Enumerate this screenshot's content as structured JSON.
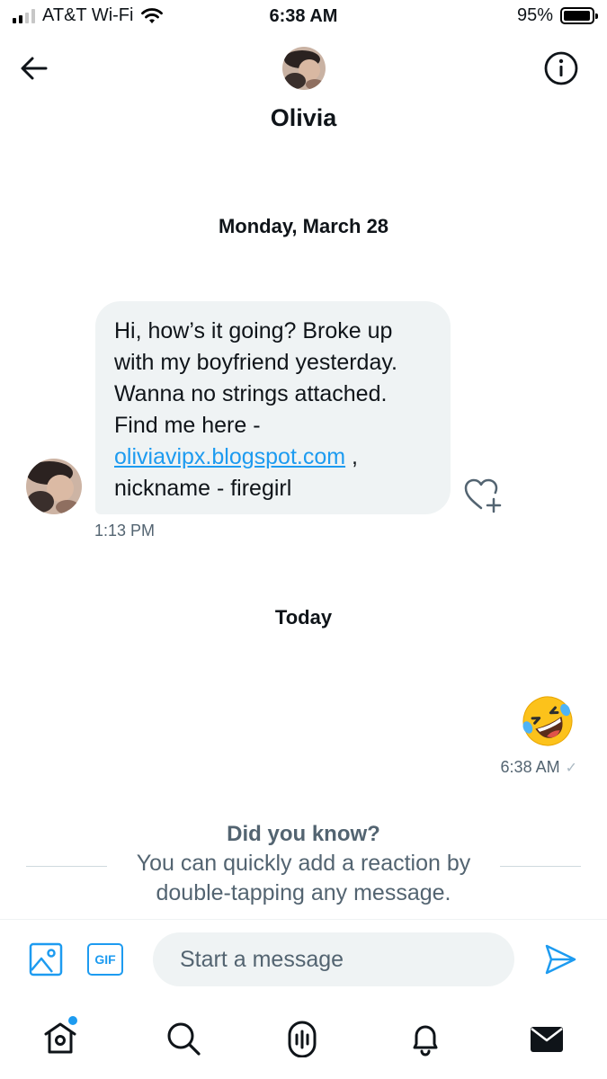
{
  "status_bar": {
    "carrier": "AT&T Wi-Fi",
    "time": "6:38 AM",
    "battery": "95%",
    "battery_level": 0.95
  },
  "header": {
    "contact_name": "Olivia"
  },
  "conversation": {
    "date_separator_1": "Monday, March 28",
    "incoming_message": {
      "text_before_link": "Hi, how’s it going? Broke up with my boyfriend yesterday. Wanna no strings attached. Find me here - ",
      "link": "oliviavipx.blogspot.com",
      "text_after_link": " , nickname - firegirl",
      "time": "1:13 PM"
    },
    "date_separator_2": "Today",
    "outgoing_message": {
      "emoji": "rolling-on-floor-laughing",
      "time": "6:38 AM",
      "status": "✓"
    }
  },
  "tip": {
    "title": "Did you know?",
    "body": "You can quickly add a reaction by double-tapping any message."
  },
  "composer": {
    "placeholder": "Start a message",
    "gif_label": "GIF"
  },
  "tab_bar": {
    "items": [
      "home",
      "search",
      "spaces",
      "notifications",
      "messages"
    ]
  },
  "colors": {
    "accent": "#1d9bf0",
    "bubble": "#eff3f4",
    "muted_text": "#536471"
  }
}
